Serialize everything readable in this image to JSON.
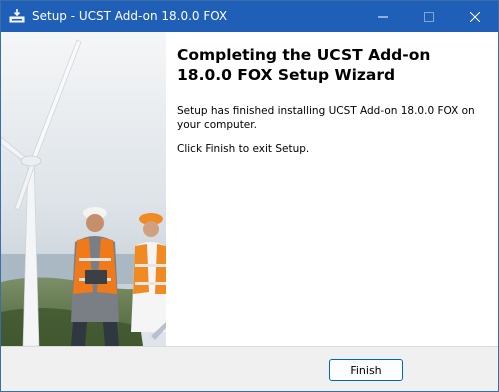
{
  "window": {
    "title": "Setup - UCST Add-on 18.0.0 FOX",
    "controls": {
      "minimize": "minimize",
      "maximize": "maximize",
      "close": "close"
    }
  },
  "banner": {
    "image": "wind-turbine-engineers-photo"
  },
  "content": {
    "heading": "Completing the UCST Add-on 18.0.0 FOX Setup Wizard",
    "body_1": "Setup has finished installing UCST Add-on 18.0.0 FOX on your computer.",
    "body_2": "Click Finish to exit Setup."
  },
  "footer": {
    "finish_label": "Finish"
  },
  "colors": {
    "titlebar": "#1f5fb8",
    "accent": "#0067c0",
    "content_bg": "#ffffff",
    "footer_bg": "#f0f0f0"
  }
}
